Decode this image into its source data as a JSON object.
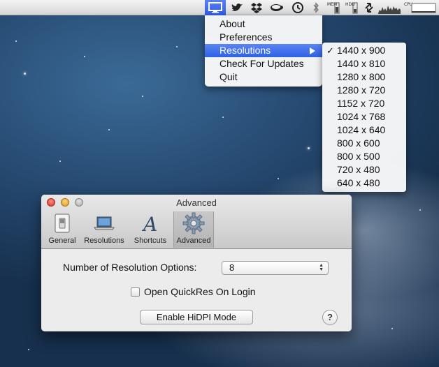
{
  "menubar": {
    "icons": [
      {
        "name": "display-icon",
        "active": true
      },
      {
        "name": "twitter-bird-icon"
      },
      {
        "name": "dropbox-icon"
      },
      {
        "name": "coffee-cup-icon"
      },
      {
        "name": "time-machine-icon"
      },
      {
        "name": "bluetooth-icon"
      },
      {
        "name": "memory-meter-icon"
      },
      {
        "name": "hdd-meter-icon"
      },
      {
        "name": "network-arrows-icon"
      },
      {
        "name": "activity-graph-icon"
      },
      {
        "name": "cpu-meter-icon"
      }
    ],
    "meter_labels": {
      "mem": "MEM",
      "hdd": "HDD",
      "cpu": "CPU"
    }
  },
  "app_menu": {
    "items": [
      "About",
      "Preferences",
      "Resolutions",
      "Check For Updates",
      "Quit"
    ],
    "highlighted": "Resolutions"
  },
  "resolutions_submenu": {
    "items": [
      "1440 x 900",
      "1440 x 810",
      "1280 x 800",
      "1280 x 720",
      "1152 x 720",
      "1024 x 768",
      "1024 x 640",
      "800 x 600",
      "800 x 500",
      "720 x 480",
      "640 x 480"
    ],
    "checked": "1440 x 900",
    "check_mark": "✓"
  },
  "prefs_window": {
    "title": "Advanced",
    "toolbar": [
      {
        "label": "General",
        "icon": "switch-icon"
      },
      {
        "label": "Resolutions",
        "icon": "laptop-icon"
      },
      {
        "label": "Shortcuts",
        "icon": "font-a-icon"
      },
      {
        "label": "Advanced",
        "icon": "gear-icon",
        "selected": true
      }
    ],
    "number_label": "Number of Resolution Options:",
    "number_value": "8",
    "login_label": "Open QuickRes On Login",
    "login_checked": false,
    "hidpi_button": "Enable HiDPI Mode",
    "help_label": "?"
  },
  "colors": {
    "menu_highlight": "#2f61e5",
    "desktop": "#25486f"
  }
}
